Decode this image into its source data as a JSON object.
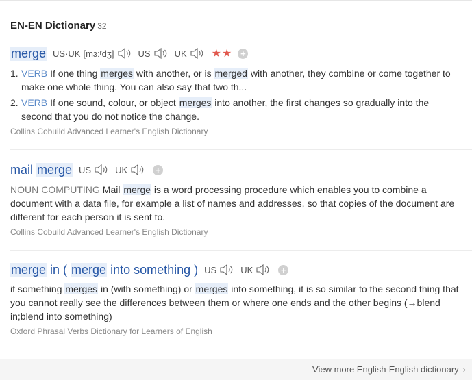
{
  "header": {
    "title": "EN-EN Dictionary",
    "count": "32"
  },
  "entries": [
    {
      "headword": "merge",
      "phonetic_label": "US·UK",
      "phonetic": "[mɜːʳdʒ]",
      "us": "US",
      "uk": "UK",
      "stars": "★★",
      "add": "+",
      "senses": [
        {
          "num": "1.",
          "pos": "VERB",
          "parts": [
            "If one thing ",
            "merges",
            " with another, or is ",
            "merged",
            " with another, they combine or come together to make one whole thing. You can also say that two th..."
          ]
        },
        {
          "num": "2.",
          "pos": "VERB",
          "parts": [
            "If one sound, colour, or object ",
            "merges",
            " into another, the first changes so gradually into the second that you do not notice the change."
          ]
        }
      ],
      "source": "Collins Cobuild Advanced Learner's English Dictionary"
    },
    {
      "headword_a": "mail ",
      "headword_b": "merge",
      "us": "US",
      "uk": "UK",
      "add": "+",
      "pos": "NOUN",
      "field": "COMPUTING",
      "parts": [
        "Mail ",
        "merge",
        " is a word processing procedure which enables you to combine a document with a data file, for example a list of names and addresses, so that copies of the document are different for each person it is sent to."
      ],
      "source": "Collins Cobuild Advanced Learner's English Dictionary"
    },
    {
      "hw_parts": [
        "merge",
        " in ( ",
        "merge",
        " into something )"
      ],
      "us": "US",
      "uk": "UK",
      "add": "+",
      "parts": [
        "if something ",
        "merges",
        " in (with something) or ",
        "merges",
        " into something, it is so similar to the second thing that you cannot really see the differences between them or where one ends and the other begins (→blend in;blend into something)"
      ],
      "source": "Oxford Phrasal Verbs Dictionary for Learners of English"
    }
  ],
  "footer": {
    "more": "View more English-English dictionary",
    "chevron": "›"
  }
}
